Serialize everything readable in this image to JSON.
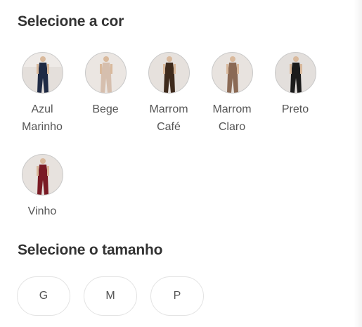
{
  "color_section": {
    "title": "Selecione a cor",
    "options": [
      {
        "label": "Azul\nMarinho",
        "icon": "azul-marinho-outfit-icon",
        "color": "#1f2a44"
      },
      {
        "label": "Bege",
        "icon": "bege-outfit-icon",
        "color": "#d6bfae"
      },
      {
        "label": "Marrom\nCafé",
        "icon": "marrom-cafe-outfit-icon",
        "color": "#3e2a1c"
      },
      {
        "label": "Marrom\nClaro",
        "icon": "marrom-claro-outfit-icon",
        "color": "#8b6a55"
      },
      {
        "label": "Preto",
        "icon": "preto-outfit-icon",
        "color": "#1b1b1b"
      },
      {
        "label": "Vinho",
        "icon": "vinho-outfit-icon",
        "color": "#7a1a24"
      }
    ]
  },
  "size_section": {
    "title": "Selecione o tamanho",
    "options": [
      "G",
      "M",
      "P"
    ]
  }
}
